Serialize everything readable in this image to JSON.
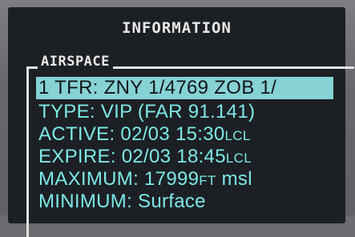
{
  "page": {
    "title": "INFORMATION",
    "group_label": "AIRSPACE"
  },
  "rows": {
    "r1": "1 TFR: ZNY 1/4769 ZOB 1/",
    "r2": "TYPE: VIP (FAR 91.141)",
    "r3_label": "ACTIVE: 02/03 15:30",
    "r3_unit": "LCL",
    "r4_label": "EXPIRE: 02/03 18:45",
    "r4_unit": "LCL",
    "r5_label": "MAXIMUM: 17999",
    "r5_unit": "FT",
    "r5_suffix": " msl",
    "r6": "MINIMUM: Surface"
  },
  "colors": {
    "text": "#7de8e8",
    "highlight": "#86d2d4",
    "screen": "#1c2024"
  }
}
